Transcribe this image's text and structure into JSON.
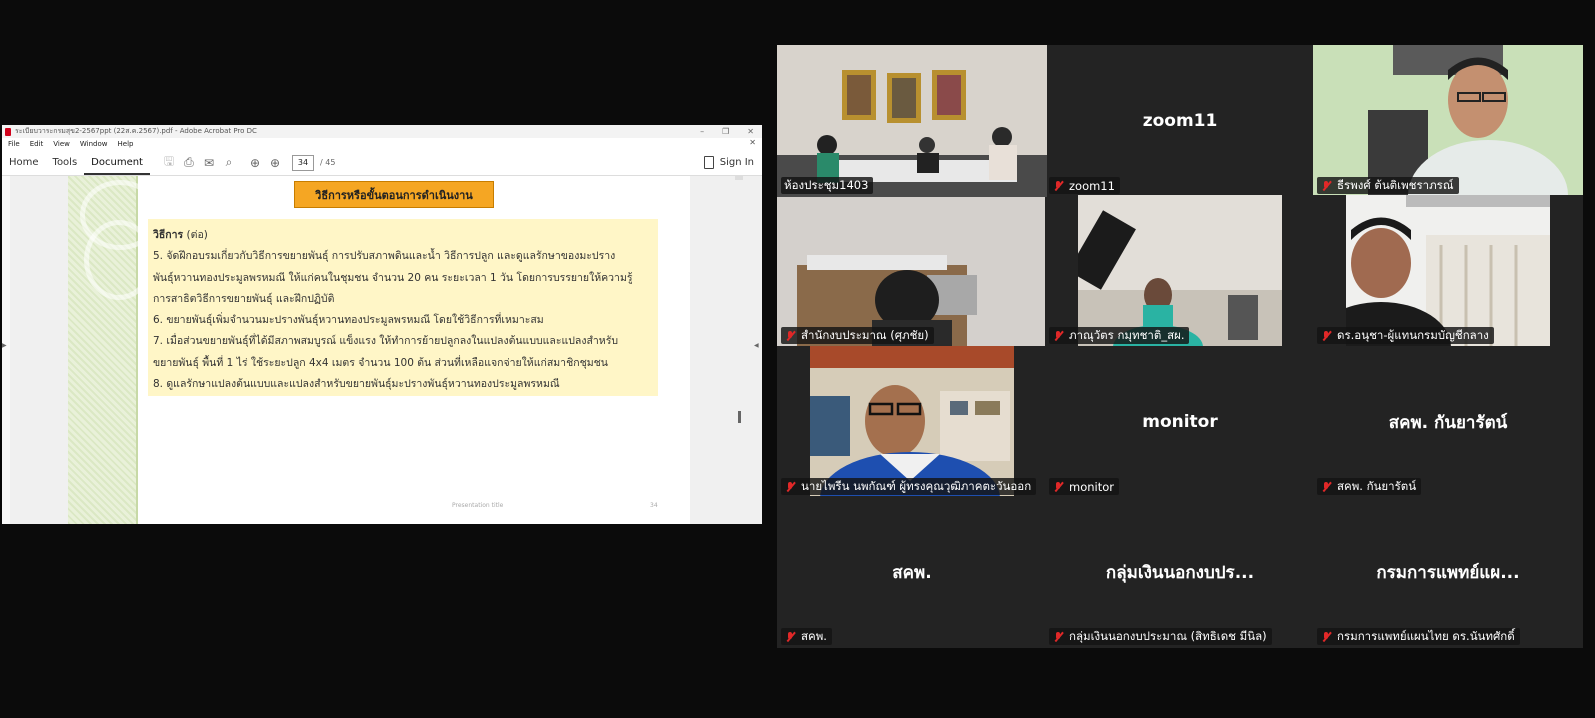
{
  "acrobat": {
    "window_title": "ระเบียบวาระกรมสุข2-2567ppt (22ส.ค.2567).pdf - Adobe Acrobat Pro DC",
    "menu": [
      "File",
      "Edit",
      "View",
      "Window",
      "Help"
    ],
    "tabs": [
      "Home",
      "Tools",
      "Document"
    ],
    "active_tab": "Document",
    "current_page": "34",
    "total_pages": "/ 45",
    "sign_in": "Sign In"
  },
  "slide": {
    "heading": "วิธีการหรือขั้นตอนการดำเนินงาน",
    "subtitle_bold": "วิธีการ",
    "subtitle_rest": " (ต่อ)",
    "lines": [
      "5. จัดฝึกอบรมเกี่ยวกับวิธีการขยายพันธุ์ การปรับสภาพดินและน้ำ วิธีการปลูก และดูแลรักษาของมะปราง",
      "พันธุ์หวานทองประมูลพรหมณี ให้แก่คนในชุมชน จำนวน 20 คน ระยะเวลา 1 วัน โดยการบรรยายให้ความรู้",
      "การสาธิตวิธีการขยายพันธุ์ และฝึกปฏิบัติ",
      "6. ขยายพันธุ์เพิ่มจำนวนมะปรางพันธุ์หวานทองประมูลพรหมณี โดยใช้วิธีการที่เหมาะสม",
      "7. เมื่อส่วนขยายพันธุ์ที่ได้มีสภาพสมบูรณ์ แข็งแรง ให้ทำการย้ายปลูกลงในแปลงต้นแบบและแปลงสำหรับ",
      "ขยายพันธุ์ พื้นที่ 1 ไร่ ใช้ระยะปลูก 4x4 เมตร จำนวน 100 ต้น ส่วนที่เหลือแจกจ่ายให้แก่สมาชิกชุมชน",
      "8. ดูแลรักษาแปลงต้นแบบและแปลงสำหรับขยายพันธุ์มะปรางพันธุ์หวานทองประมูลพรหมณี"
    ],
    "footer_title": "Presentation title",
    "footer_page": "34"
  },
  "participants": [
    {
      "name": "ห้องประชุม1403",
      "display": "",
      "speaking": true,
      "video": "meeting-room"
    },
    {
      "name": "zoom11",
      "display": "zoom11",
      "speaking": false,
      "video": ""
    },
    {
      "name": "ธีรพงศ์ ต้นติเพชราภรณ์",
      "display": "",
      "speaking": false,
      "video": "man-glasses"
    },
    {
      "name": "สำนักงบประมาณ (ศุภชัย)",
      "display": "",
      "speaking": false,
      "video": "office"
    },
    {
      "name": "ภาณุวัตร กมุทชาติ_สผ.",
      "display": "",
      "speaking": false,
      "video": "ceiling"
    },
    {
      "name": "ดร.อนุชา-ผู้แทนกรมบัญชีกลาง",
      "display": "",
      "speaking": false,
      "video": "office-window"
    },
    {
      "name": "นายไพรีน นพกัณฑ์  ผู้ทรงคุณวุฒิภาคตะวันออก",
      "display": "",
      "speaking": false,
      "video": "man-blue-shirt"
    },
    {
      "name": "monitor",
      "display": "monitor",
      "speaking": false,
      "video": ""
    },
    {
      "name": "สคพ. กันยารัตน์",
      "display": "สคพ. กันยารัตน์",
      "speaking": false,
      "video": ""
    },
    {
      "name": "สคพ.",
      "display": "สคพ.",
      "speaking": false,
      "video": ""
    },
    {
      "name": "กลุ่มเงินนอกงบประมาณ (สิทธิเดช  มีนิล)",
      "display": "กลุ่มเงินนอกงบปร...",
      "speaking": false,
      "video": ""
    },
    {
      "name": "กรมการแพทย์แผนไทย ดร.นันทศักดิ์",
      "display": "กรมการแพทย์แผ...",
      "speaking": false,
      "video": ""
    }
  ],
  "colors": {
    "speaking_outline": "#23d18b",
    "mute_icon": "#e02828",
    "heading_box": "#f5a623",
    "content_box": "#fff6c7"
  }
}
